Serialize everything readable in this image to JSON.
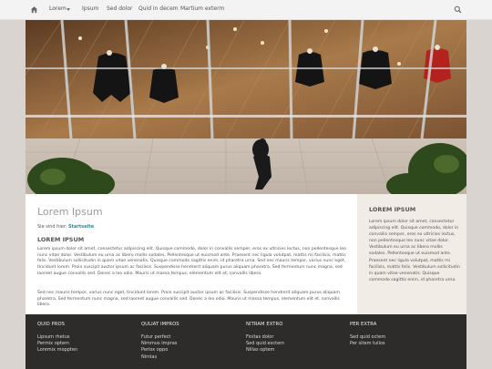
{
  "nav": {
    "items": [
      "Lorem",
      "Ipsum",
      "Sed dolor",
      "Quid in decem",
      "Martium exterm"
    ]
  },
  "hero": {
    "alt": ""
  },
  "main": {
    "title": "Lorem Ipsum",
    "breadcrumb_prefix": "Sie sind hier:",
    "breadcrumb_current": "Startseite",
    "section_heading": "LOREM IPSUM",
    "paragraph1": "Lorem ipsum dolor sit amet, consectetur adipiscing elit. Quisque commodo, dolor in convallis semper, eros ex ultricies lectus, non pellentesque leo nunc vitae dolor. Vestibulum eu urna ac libero mollis sodales. Pellentesque ut euismod ante. Praesent nec ligula volutpat, mattis mi facilisis, mattis felis. Vestibulum sollicitudin in quam vitae venenatis. Quisque commodo sagittis enim, id pharetra urna. Sed nec mauris tempor, varius nunc eget, tincidunt lorem. Proin suscipit auctor ipsum ac facilisis. Suspendisse hendrerit aliquam purus aliquam pharetra. Sed fermentum nunc magna, sed laoreet augue convallis sed. Donec a leo odio. Mauris ut massa tempus, elementum elit et, convallis libero.",
    "paragraph2": "Sed nec mauris tempor, varius nunc eget, tincidunt lorem. Proin suscipit auctor ipsum ac facilisis. Suspendisse hendrerit aliquam purus aliquam pharetra. Sed fermentum nunc magna, sed laoreet augue convallis sed. Donec a leo odio. Mauris ut massa tempus, elementum elit et, convallis libero."
  },
  "aside": {
    "heading": "LOREM IPSUM",
    "text": "Lorem ipsum dolor sit amet, consectetur adipiscing elit. Quisque commodo, dolor in convallis semper, eros ex ultricies lectus, non pellentesque leo nunc vitae dolor. Vestibulum eu urna ac libero mollis sodales. Pellentesque ut euismod ante. Praesent nec ligula volutpat, mattis mi facilisis, mattis felis. Vestibulum sollicitudin in quam vitae venenatis. Quisque commodo sagittis enim, id pharetra urna."
  },
  "footer": {
    "columns": [
      {
        "heading": "QUID PROS",
        "links": [
          "Lipsum rhetus",
          "Permix optem",
          "Loremix moppten"
        ]
      },
      {
        "heading": "QULIAT IMPROS",
        "links": [
          "Futur perfect",
          "Nimmus impras",
          "Perlox oppo",
          "Nimlas"
        ]
      },
      {
        "heading": "NITRAM EXTRO",
        "links": [
          "Finitas dolor",
          "Sed quid exctem",
          "Nillas optem"
        ]
      },
      {
        "heading": "PER EXTRA",
        "links": [
          "Sed quid octem",
          "Per sitem tulios"
        ]
      }
    ]
  },
  "colors": {
    "accent_link": "#2a8a9a",
    "footer_bg": "#2d2c2b",
    "page_bg": "#d9d4cf",
    "aside_bg": "#f1ece6"
  },
  "icons": [
    "home-icon",
    "search-icon",
    "caret-down-icon"
  ]
}
